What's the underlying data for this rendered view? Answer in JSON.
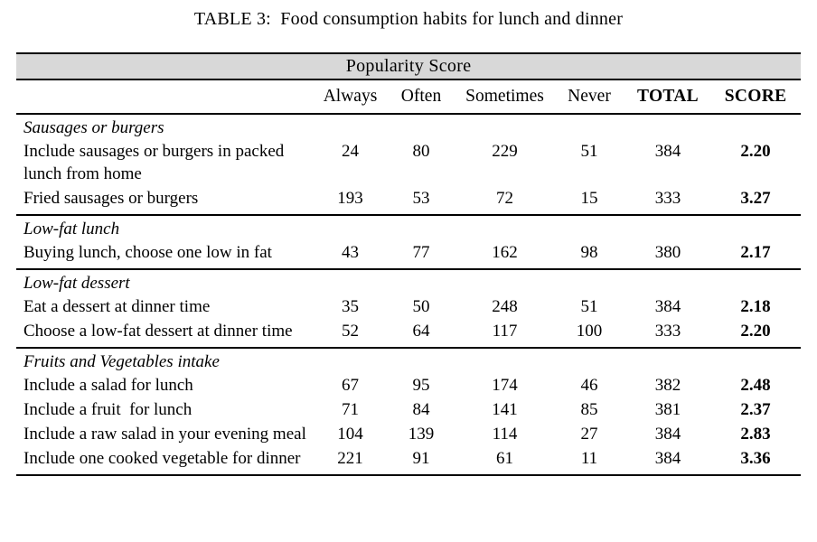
{
  "caption": "TABLE 3:  Food consumption habits for lunch and dinner",
  "banner": {
    "label": "Popularity Score"
  },
  "columns": {
    "label": "",
    "always": "Always",
    "often": "Often",
    "sometimes": "Sometimes",
    "never": "Never",
    "total": "TOTAL",
    "score": "SCORE"
  },
  "colors": {
    "banner_bg": "#d8d8d8",
    "rule": "#000000",
    "text": "#000000",
    "page_bg": "#ffffff"
  },
  "sections": [
    {
      "title": "Sausages or burgers",
      "rows": [
        {
          "label": "Include sausages or burgers in packed lunch from home",
          "always": "24",
          "often": "80",
          "sometimes": "229",
          "never": "51",
          "total": "384",
          "score": "2.20"
        },
        {
          "label": "Fried sausages or burgers",
          "always": "193",
          "often": "53",
          "sometimes": "72",
          "never": "15",
          "total": "333",
          "score": "3.27"
        }
      ]
    },
    {
      "title": "Low-fat lunch",
      "rows": [
        {
          "label": "Buying lunch, choose one low in fat",
          "always": "43",
          "often": "77",
          "sometimes": "162",
          "never": "98",
          "total": "380",
          "score": "2.17"
        }
      ]
    },
    {
      "title": "Low-fat dessert",
      "rows": [
        {
          "label": "Eat a dessert at dinner time",
          "always": "35",
          "often": "50",
          "sometimes": "248",
          "never": "51",
          "total": "384",
          "score": "2.18"
        },
        {
          "label": "Choose a low-fat dessert at dinner time",
          "always": "52",
          "often": "64",
          "sometimes": "117",
          "never": "100",
          "total": "333",
          "score": "2.20"
        }
      ]
    },
    {
      "title": "Fruits and Vegetables intake",
      "rows": [
        {
          "label": "Include a salad for lunch",
          "always": "67",
          "often": "95",
          "sometimes": "174",
          "never": "46",
          "total": "382",
          "score": "2.48"
        },
        {
          "label": "Include a fruit  for lunch",
          "always": "71",
          "often": "84",
          "sometimes": "141",
          "never": "85",
          "total": "381",
          "score": "2.37"
        },
        {
          "label": "Include a raw salad in your evening meal",
          "always": "104",
          "often": "139",
          "sometimes": "114",
          "never": "27",
          "total": "384",
          "score": "2.83"
        },
        {
          "label": "Include one cooked vegetable for dinner",
          "always": "221",
          "often": "91",
          "sometimes": "61",
          "never": "11",
          "total": "384",
          "score": "3.36"
        }
      ]
    }
  ]
}
